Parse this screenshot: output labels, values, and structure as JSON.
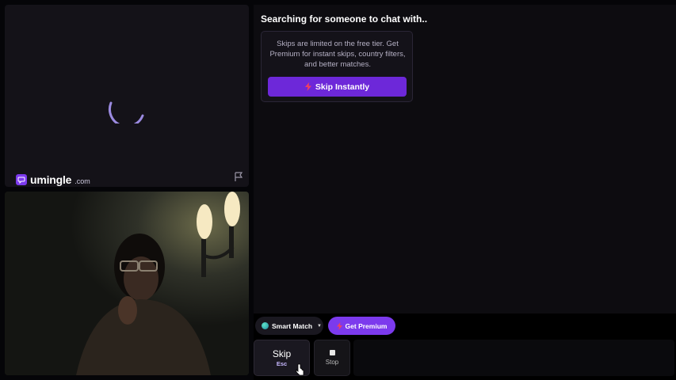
{
  "stranger_panel": {
    "logo": {
      "word": "umingle",
      "tld": ".com"
    },
    "flag_icon": "flag-icon"
  },
  "chat": {
    "status_title": "Searching for someone to chat with..",
    "skip_card": {
      "text": "Skips are limited on the free tier. Get Premium for instant skips, country filters, and better matches.",
      "button_label": "Skip Instantly"
    }
  },
  "mode_bar": {
    "smart_match_label": "Smart Match",
    "get_premium_label": "Get Premium"
  },
  "actions": {
    "skip_label": "Skip",
    "skip_key": "Esc",
    "stop_label": "Stop"
  },
  "colors": {
    "accent": "#7c3aed",
    "bolt": "#f43f5e"
  }
}
